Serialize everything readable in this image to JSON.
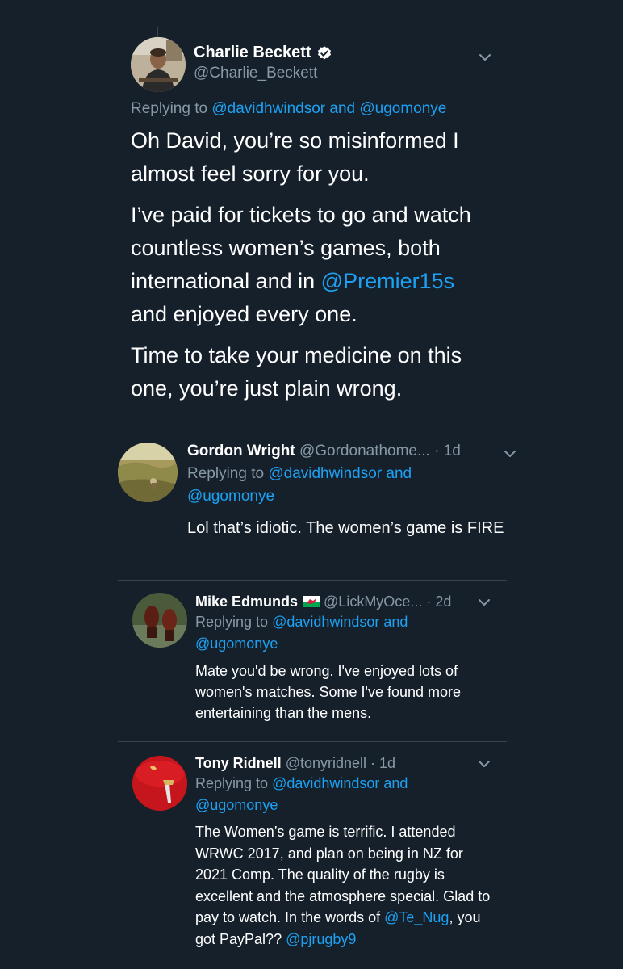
{
  "main_tweet": {
    "name": "Charlie Beckett",
    "handle": "@Charlie_Beckett",
    "replying_prefix": "Replying to ",
    "replying_user1": "@davidhwindsor",
    "replying_and": " and ",
    "replying_user2": "@ugomonye",
    "para1": "Oh David, you’re so misinformed I almost feel sorry for you.",
    "para2_before": "I’ve paid for tickets to go and watch countless women’s games, both international and in ",
    "para2_mention": "@Premier15s",
    "para2_after": " and enjoyed every one.",
    "para3": "Time to take your medicine on this one, you’re just plain wrong."
  },
  "replies": [
    {
      "name": "Gordon Wright",
      "handle": "@Gordonathome...",
      "time": " · 1d",
      "replying_prefix": "Replying to ",
      "replying_user1": "@davidhwindsor",
      "replying_and": " and",
      "replying_user2": "@ugomonye",
      "text": "Lol that’s idiotic. The women’s game is FIRE"
    },
    {
      "name": "Mike Edmunds",
      "handle": "@LickMyOce...",
      "time": " · 2d",
      "replying_prefix": "Replying to ",
      "replying_user1": "@davidhwindsor",
      "replying_and": " and",
      "replying_user2": "@ugomonye",
      "text": "Mate you'd be wrong. I've enjoyed lots of women's matches. Some I've found more entertaining than the mens."
    },
    {
      "name": "Tony Ridnell",
      "handle": "@tonyridnell",
      "time": " · 1d",
      "replying_prefix": "Replying to ",
      "replying_user1": "@davidhwindsor",
      "replying_and": " and",
      "replying_user2": "@ugomonye",
      "text_before": "The Women’s game is terrific. I attended WRWC 2017, and plan on being in NZ for 2021 Comp. The quality of the rugby is excellent and the atmosphere special. Glad to pay to watch. In the words of ",
      "text_mention1": "@Te_Nug",
      "text_middle": ", you got PayPal?? ",
      "text_mention2": "@pjrugby9"
    }
  ],
  "icons": {
    "verified": "verified-badge-icon",
    "chevron": "chevron-down-icon",
    "flag": "wales-flag-icon"
  },
  "colors": {
    "background": "#15202b",
    "text": "#ffffff",
    "secondary": "#8899a6",
    "link": "#1da1f2",
    "divider": "#38444d"
  }
}
